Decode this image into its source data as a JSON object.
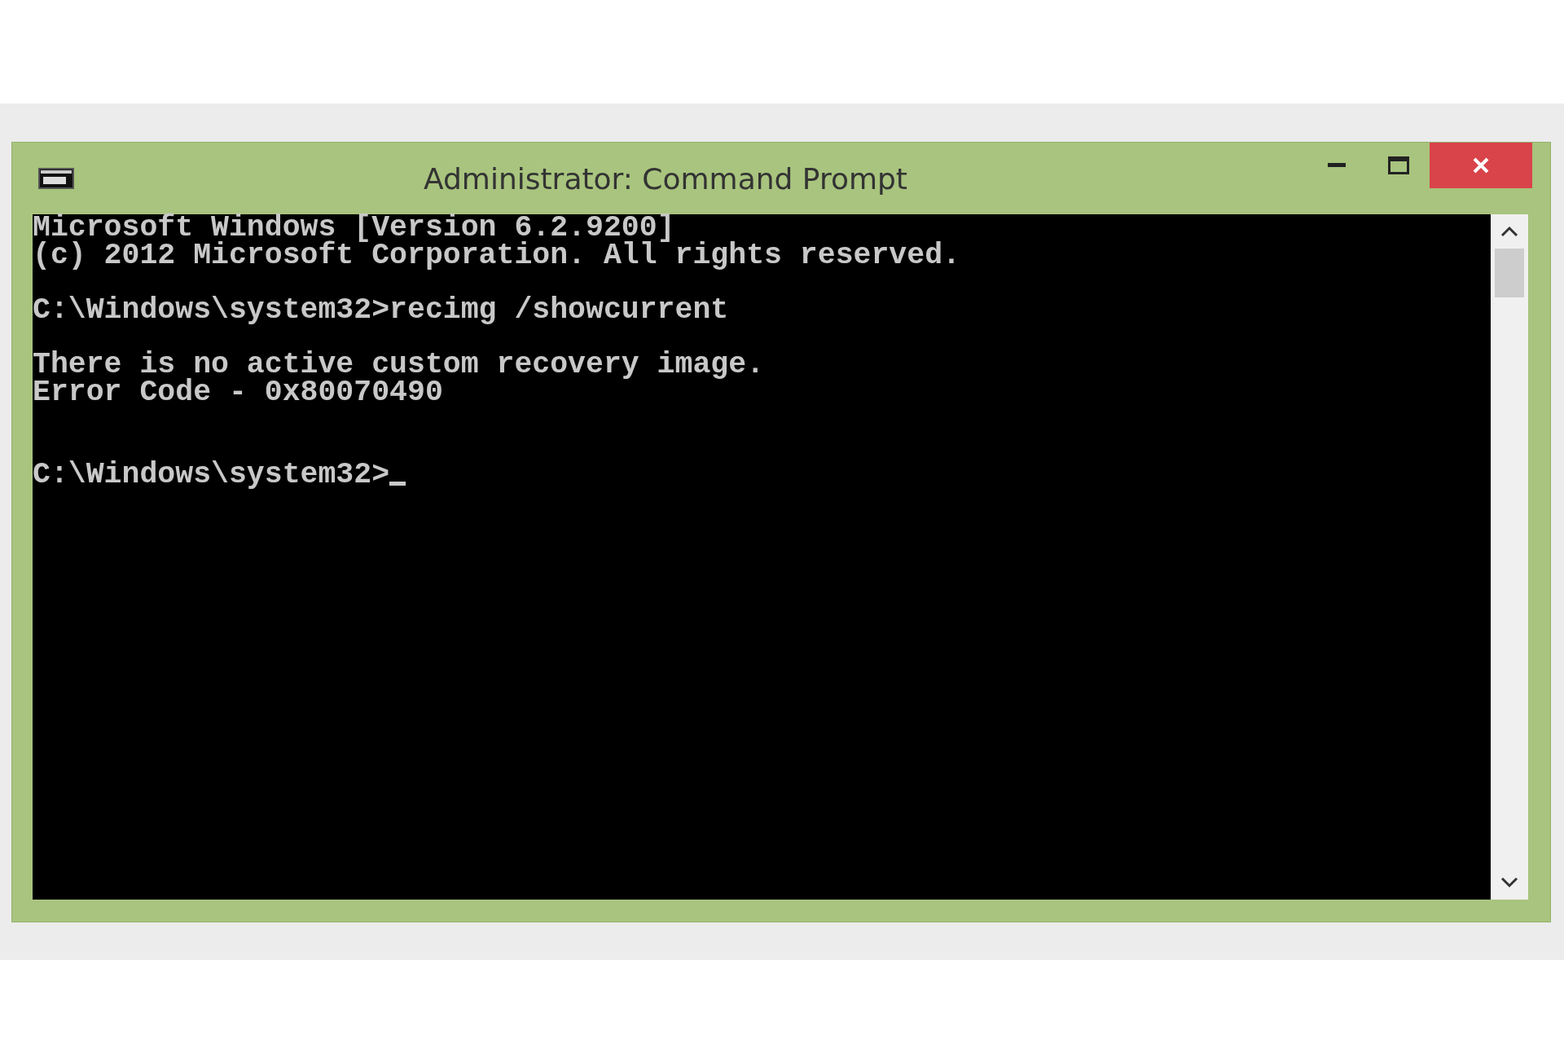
{
  "window": {
    "title": "Administrator: Command Prompt"
  },
  "console": {
    "lines": [
      {
        "kind": "text",
        "text": "Microsoft Windows [Version 6.2.9200]",
        "cursor": false
      },
      {
        "kind": "text",
        "text": "(c) 2012 Microsoft Corporation. All rights reserved.",
        "cursor": false
      },
      {
        "kind": "blank"
      },
      {
        "kind": "text",
        "text": "C:\\Windows\\system32>recimg /showcurrent",
        "cursor": false
      },
      {
        "kind": "blank"
      },
      {
        "kind": "text",
        "text": "There is no active custom recovery image.",
        "cursor": false
      },
      {
        "kind": "text",
        "text": "Error Code - 0x80070490",
        "cursor": false
      },
      {
        "kind": "blank"
      },
      {
        "kind": "blank"
      },
      {
        "kind": "text",
        "text": "C:\\Windows\\system32>",
        "cursor": true
      }
    ]
  }
}
